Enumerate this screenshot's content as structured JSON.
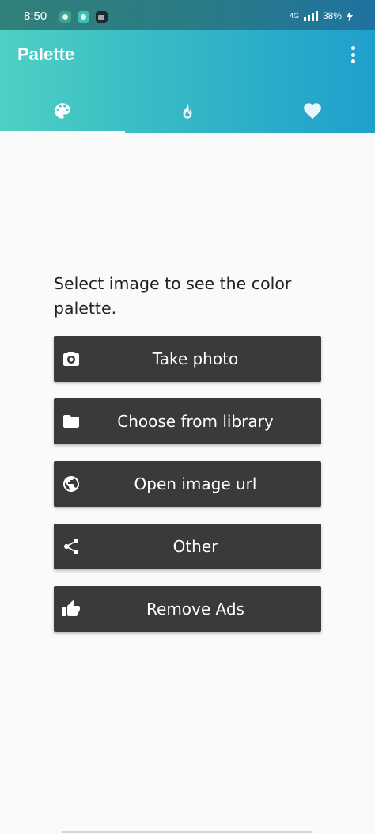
{
  "status_bar": {
    "time": "8:50",
    "network": "4G",
    "battery": "38%",
    "app_icons": [
      "app-icon",
      "app-icon",
      "app-icon"
    ]
  },
  "app_bar": {
    "title": "Palette",
    "menu_icon": "more-vert-icon"
  },
  "tabs": [
    {
      "icon": "palette-icon",
      "selected": true
    },
    {
      "icon": "flame-icon",
      "selected": false
    },
    {
      "icon": "heart-icon",
      "selected": false
    }
  ],
  "main": {
    "prompt": "Select image to see the color palette."
  },
  "buttons": [
    {
      "label": "Take photo",
      "icon": "camera-icon"
    },
    {
      "label": "Choose from library",
      "icon": "folder-icon"
    },
    {
      "label": "Open image url",
      "icon": "globe-icon"
    },
    {
      "label": "Other",
      "icon": "share-icon"
    },
    {
      "label": "Remove Ads",
      "icon": "thumb-up-icon"
    }
  ],
  "colors": {
    "app_bar_start": "#4fd0c4",
    "app_bar_end": "#1f9fcd",
    "button_bg": "#3a3a3a",
    "page_bg": "#fafafa"
  }
}
